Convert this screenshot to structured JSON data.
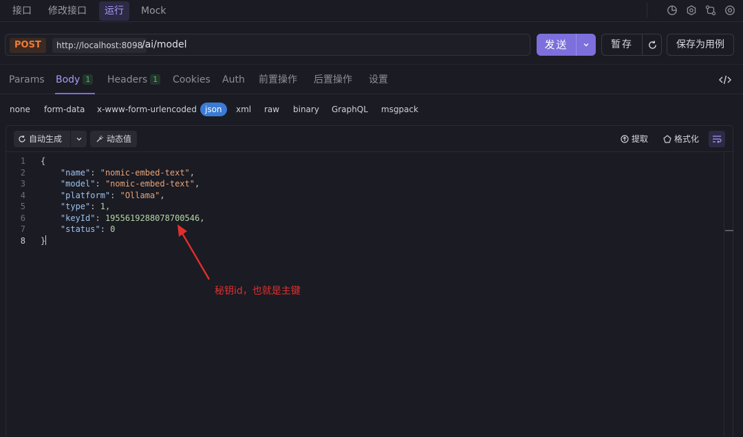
{
  "top_tabs": [
    {
      "label": "接口"
    },
    {
      "label": "修改接口"
    },
    {
      "label": "运行"
    },
    {
      "label": "Mock"
    }
  ],
  "top_icons": [
    "chart-icon",
    "hexagon-icon",
    "share-icon",
    "settings-icon"
  ],
  "request": {
    "method": "POST",
    "base_url": "http://localhost:8098",
    "path": "/ai/model",
    "send_label": "发送",
    "save_label": "暂存",
    "save_as_label": "保存为用例"
  },
  "param_tabs": [
    {
      "label": "Params"
    },
    {
      "label": "Body",
      "badge": "1"
    },
    {
      "label": "Headers",
      "badge": "1"
    },
    {
      "label": "Cookies"
    },
    {
      "label": "Auth"
    },
    {
      "label": "前置操作"
    },
    {
      "label": "后置操作"
    },
    {
      "label": "设置"
    }
  ],
  "body_types": [
    "none",
    "form-data",
    "x-www-form-urlencoded",
    "json",
    "xml",
    "raw",
    "binary",
    "GraphQL",
    "msgpack"
  ],
  "editor_toolbar": {
    "auto_generate": "自动生成",
    "dynamic_value": "动态值",
    "extract": "提取",
    "format": "格式化"
  },
  "code_lines": [
    {
      "num": "1",
      "parts": [
        [
          "p",
          "{"
        ]
      ]
    },
    {
      "num": "2",
      "parts": [
        [
          "p",
          "    "
        ],
        [
          "k",
          "\"name\""
        ],
        [
          "p",
          ": "
        ],
        [
          "s",
          "\"nomic-embed-text\""
        ],
        [
          "p",
          ","
        ]
      ]
    },
    {
      "num": "3",
      "parts": [
        [
          "p",
          "    "
        ],
        [
          "k",
          "\"model\""
        ],
        [
          "p",
          ": "
        ],
        [
          "s",
          "\"nomic-embed-text\""
        ],
        [
          "p",
          ","
        ]
      ]
    },
    {
      "num": "4",
      "parts": [
        [
          "p",
          "    "
        ],
        [
          "k",
          "\"platform\""
        ],
        [
          "p",
          ": "
        ],
        [
          "s",
          "\"Ollama\""
        ],
        [
          "p",
          ","
        ]
      ]
    },
    {
      "num": "5",
      "parts": [
        [
          "p",
          "    "
        ],
        [
          "k",
          "\"type\""
        ],
        [
          "p",
          ": "
        ],
        [
          "n",
          "1"
        ],
        [
          "p",
          ","
        ]
      ]
    },
    {
      "num": "6",
      "parts": [
        [
          "p",
          "    "
        ],
        [
          "k",
          "\"keyId\""
        ],
        [
          "p",
          ": "
        ],
        [
          "n",
          "1955619288078700546"
        ],
        [
          "p",
          ","
        ]
      ]
    },
    {
      "num": "7",
      "parts": [
        [
          "p",
          "    "
        ],
        [
          "k",
          "\"status\""
        ],
        [
          "p",
          ": "
        ],
        [
          "n",
          "0"
        ]
      ]
    },
    {
      "num": "8",
      "parts": [
        [
          "p",
          "}"
        ]
      ]
    }
  ],
  "annotation": {
    "text": "秘钥id，也就是主键",
    "color": "#e0302e"
  },
  "colors": {
    "accent": "#7d6fdc",
    "method_post": "#f07a3a",
    "json_active": "#3a7bd5"
  }
}
